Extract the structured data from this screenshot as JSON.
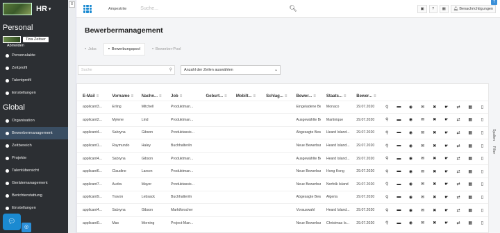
{
  "brand": {
    "title": "HR"
  },
  "sidebar": {
    "section_personal": "Personal",
    "user_name": "Tina Zeitser",
    "user_sub": "Abmelden",
    "personal_items": [
      {
        "label": "Personalakte",
        "icon": "folder-icon"
      },
      {
        "label": "Zeitprofil",
        "icon": "clock-icon"
      },
      {
        "label": "Talentprofil",
        "icon": "star-icon"
      },
      {
        "label": "Einstellungen",
        "icon": "gear-icon"
      }
    ],
    "section_global": "Global",
    "global_items": [
      {
        "label": "Organisation",
        "icon": "org-icon"
      },
      {
        "label": "Bewerbermanagement",
        "icon": "person-icon",
        "active": true
      },
      {
        "label": "Zeitbereich",
        "icon": "clock-icon"
      },
      {
        "label": "Projekte",
        "icon": "project-icon"
      },
      {
        "label": "Talentübersicht",
        "icon": "star-icon"
      },
      {
        "label": "Gerätemanagement",
        "icon": "device-icon"
      },
      {
        "label": "Berichterstattung",
        "icon": "report-icon"
      },
      {
        "label": "Einstellungen",
        "icon": "gear-icon"
      }
    ]
  },
  "topbar": {
    "app_name": "Ampestrite",
    "search_placeholder": "Suche...",
    "notifications_label": "Benachrichtigungen",
    "notifications_count": "7"
  },
  "main": {
    "title": "Bewerbermanagement",
    "tabs": [
      {
        "label": "Jobs"
      },
      {
        "label": "Bewerbungspool",
        "active": true
      },
      {
        "label": "Bewerber-Pool"
      }
    ],
    "filter_placeholder": "Suche",
    "rows_select": "Anzahl der Zeilen auswählen",
    "side_tabs": [
      "Spalten",
      "Filter"
    ]
  },
  "table": {
    "columns": [
      "E-Mail",
      "Vorname",
      "Nachn...",
      "Job",
      "Geburt...",
      "Mobilt...",
      "Schlag...",
      "Bewer...",
      "Staats...",
      "Bewer..."
    ],
    "rows": [
      [
        "applicant3...",
        "Erling",
        "Mitchell",
        "Produktman...",
        "",
        "",
        "",
        "Eingeladene Bew",
        "Monaco",
        "29.07.2020"
      ],
      [
        "applicant2...",
        "Mylene",
        "Lind",
        "Produktman...",
        "",
        "",
        "",
        "Ausgewählte Bew",
        "Martinique",
        "29.07.2020"
      ],
      [
        "applicant4...",
        "Sabryna",
        "Gibson",
        "Produktassis...",
        "",
        "",
        "",
        "Abgesagte Bewe",
        "Heard Island...",
        "29.07.2020"
      ],
      [
        "applicant1...",
        "Raymundo",
        "Haley",
        "Buchhalter/in",
        "",
        "",
        "",
        "Neue Bewerbung",
        "Heard Island...",
        "29.07.2020"
      ],
      [
        "applicant4...",
        "Sabryna",
        "Gibson",
        "Produktman...",
        "",
        "",
        "",
        "Ausgewählte Bew",
        "Heard Island...",
        "29.07.2020"
      ],
      [
        "applicant6...",
        "Claudine",
        "Larson",
        "Produktman...",
        "",
        "",
        "",
        "Neue Bewerbung",
        "Hong Kong",
        "29.07.2020"
      ],
      [
        "applicant7...",
        "Audra",
        "Mayer",
        "Produktassis...",
        "",
        "",
        "",
        "Neue Bewerbung",
        "Norfolk Island",
        "29.07.2020"
      ],
      [
        "applicant9...",
        "Travon",
        "Lebsack",
        "Buchhalter/in",
        "",
        "",
        "",
        "Abgesagte Bewe",
        "Algeria",
        "29.07.2020"
      ],
      [
        "applicant4...",
        "Sabryna",
        "Gibson",
        "Marktforscher",
        "",
        "",
        "",
        "Vorauswahl",
        "Heard Island...",
        "29.07.2020"
      ],
      [
        "applicant0...",
        "Max",
        "Morning",
        "Project-Man...",
        "",
        "",
        "",
        "Neue Bewerbung",
        "Christmas Is...",
        "29.07.2020"
      ]
    ],
    "action_icons": [
      "search-icon",
      "briefcase-icon",
      "eye-icon",
      "mail-icon",
      "reject-icon",
      "thumbs-up-icon",
      "transfer-icon",
      "calendar-icon",
      "trash-icon"
    ]
  },
  "colors": {
    "accent": "#1b8ad1",
    "sidebar": "#2c2f33",
    "active_nav": "#3a4e63"
  }
}
